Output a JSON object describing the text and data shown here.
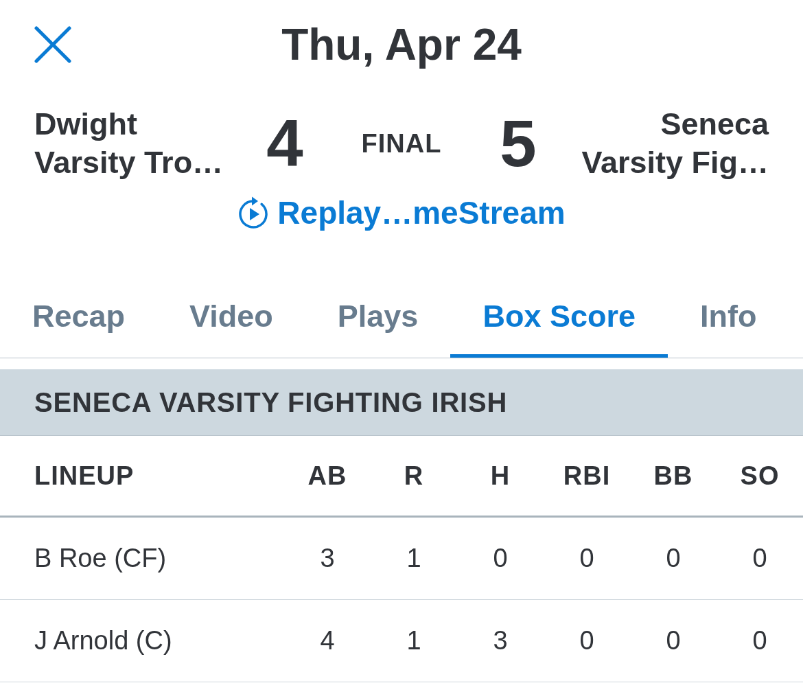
{
  "header": {
    "title": "Thu, Apr 24"
  },
  "game": {
    "home": {
      "name": "Dwight Varsity Tro…",
      "score": "4"
    },
    "status": "FINAL",
    "away": {
      "name": "Seneca Varsity Fig…",
      "score": "5"
    }
  },
  "replay_link": {
    "label": "Replay…meStream"
  },
  "tabs": [
    {
      "label": "Recap",
      "selected": false
    },
    {
      "label": "Video",
      "selected": false
    },
    {
      "label": "Plays",
      "selected": false
    },
    {
      "label": "Box Score",
      "selected": true
    },
    {
      "label": "Info",
      "selected": false
    }
  ],
  "section": {
    "title": "SENECA VARSITY FIGHTING IRISH"
  },
  "table": {
    "columns": [
      "LINEUP",
      "AB",
      "R",
      "H",
      "RBI",
      "BB",
      "SO"
    ],
    "rows": [
      {
        "player": "B Roe (CF)",
        "stats": [
          "3",
          "1",
          "0",
          "0",
          "0",
          "0"
        ]
      },
      {
        "player": "J Arnold (C)",
        "stats": [
          "4",
          "1",
          "3",
          "0",
          "0",
          "0"
        ]
      }
    ]
  }
}
